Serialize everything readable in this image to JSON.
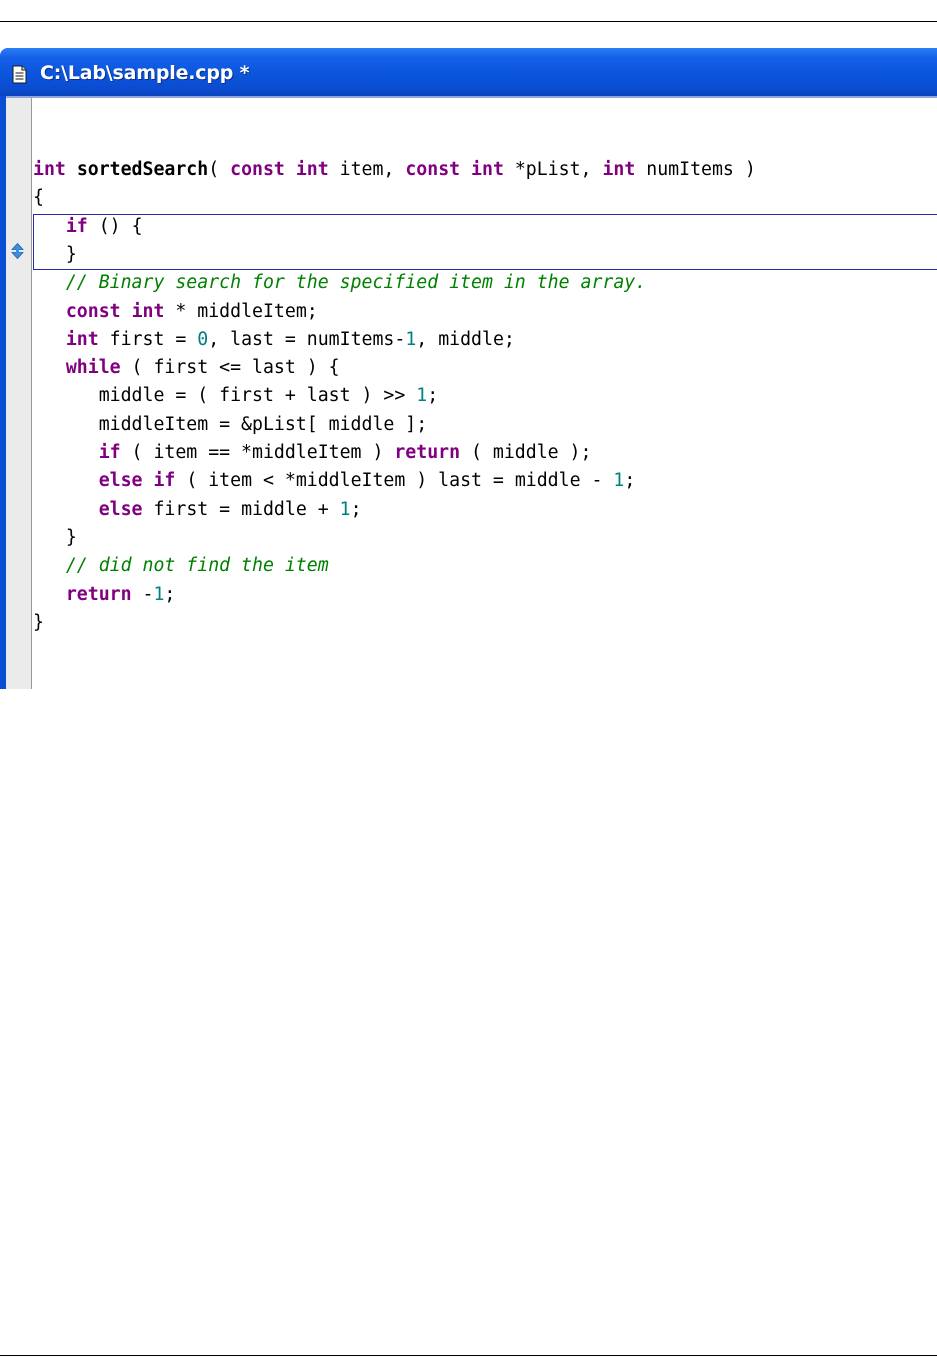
{
  "window": {
    "title": "C:\\Lab\\sample.cpp *",
    "title_icon": "document-icon"
  },
  "gutter": {
    "marker_icon": "up-down-arrows-icon"
  },
  "colors": {
    "keyword": "#800080",
    "number": "#008080",
    "comment": "#008000",
    "title_bar": "#0a55dc",
    "edit_box_border": "#2a2aa8",
    "gutter_marker": "#3c8fe0"
  },
  "code": {
    "lines": [
      [
        {
          "t": "int",
          "c": "kw"
        },
        {
          "t": " "
        },
        {
          "t": "sortedSearch",
          "c": "fn"
        },
        {
          "t": "( "
        },
        {
          "t": "const",
          "c": "kw"
        },
        {
          "t": " "
        },
        {
          "t": "int",
          "c": "kw"
        },
        {
          "t": " item, "
        },
        {
          "t": "const",
          "c": "kw"
        },
        {
          "t": " "
        },
        {
          "t": "int",
          "c": "kw"
        },
        {
          "t": " *pList, "
        },
        {
          "t": "int",
          "c": "kw"
        },
        {
          "t": " numItems )"
        }
      ],
      [
        {
          "t": "{"
        }
      ],
      [
        {
          "t": "   "
        },
        {
          "t": "if",
          "c": "kw"
        },
        {
          "t": " () {"
        }
      ],
      [
        {
          "t": "   }"
        }
      ],
      [
        {
          "t": "   "
        },
        {
          "t": "// Binary search for the specified item in the array.",
          "c": "cm"
        }
      ],
      [
        {
          "t": "   "
        },
        {
          "t": "const",
          "c": "kw"
        },
        {
          "t": " "
        },
        {
          "t": "int",
          "c": "kw"
        },
        {
          "t": " * middleItem;"
        }
      ],
      [
        {
          "t": "   "
        },
        {
          "t": "int",
          "c": "kw"
        },
        {
          "t": " first = "
        },
        {
          "t": "0",
          "c": "num"
        },
        {
          "t": ", last = numItems-"
        },
        {
          "t": "1",
          "c": "num"
        },
        {
          "t": ", middle;"
        }
      ],
      [
        {
          "t": "   "
        },
        {
          "t": "while",
          "c": "kw"
        },
        {
          "t": " ( first <= last ) {"
        }
      ],
      [
        {
          "t": "      middle = ( first + last ) >> "
        },
        {
          "t": "1",
          "c": "num"
        },
        {
          "t": ";"
        }
      ],
      [
        {
          "t": "      middleItem = &pList[ middle ];"
        }
      ],
      [
        {
          "t": "      "
        },
        {
          "t": "if",
          "c": "kw"
        },
        {
          "t": " ( item == *middleItem ) "
        },
        {
          "t": "return",
          "c": "kw"
        },
        {
          "t": " ( middle );"
        }
      ],
      [
        {
          "t": "      "
        },
        {
          "t": "else",
          "c": "kw"
        },
        {
          "t": " "
        },
        {
          "t": "if",
          "c": "kw"
        },
        {
          "t": " ( item < *middleItem ) last = middle - "
        },
        {
          "t": "1",
          "c": "num"
        },
        {
          "t": ";"
        }
      ],
      [
        {
          "t": "      "
        },
        {
          "t": "else",
          "c": "kw"
        },
        {
          "t": " first = middle + "
        },
        {
          "t": "1",
          "c": "num"
        },
        {
          "t": ";"
        }
      ],
      [
        {
          "t": "   }"
        }
      ],
      [
        {
          "t": "   "
        },
        {
          "t": "// did not find the item",
          "c": "cm"
        }
      ],
      [
        {
          "t": "   "
        },
        {
          "t": "return",
          "c": "kw"
        },
        {
          "t": " -"
        },
        {
          "t": "1",
          "c": "num"
        },
        {
          "t": ";"
        }
      ],
      [
        {
          "t": "}"
        }
      ]
    ]
  }
}
